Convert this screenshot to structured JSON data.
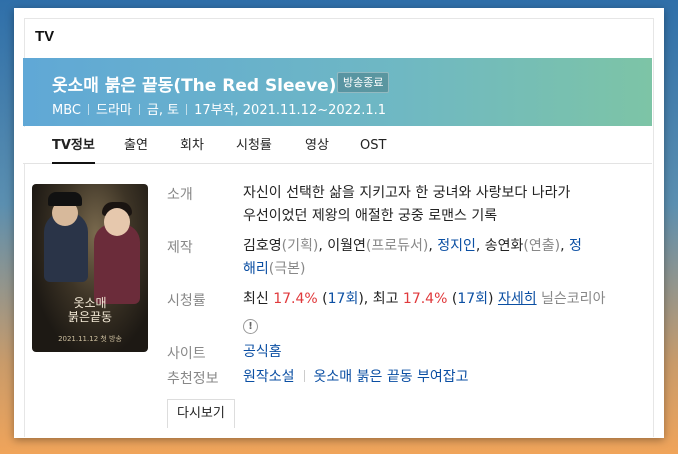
{
  "section_title": "TV",
  "show": {
    "title": "옷소매 붉은 끝동(The Red Sleeve)",
    "status_badge": "방송종료",
    "meta": [
      "MBC",
      "드라마",
      "금, 토",
      "17부작, 2021.11.12~2022.1.1"
    ]
  },
  "tabs": [
    "TV정보",
    "출연",
    "회차",
    "시청률",
    "영상",
    "OST"
  ],
  "poster": {
    "title_line1": "옷소매",
    "title_line2": "붉은끝동",
    "date_text": "2021.11.12 첫 방송"
  },
  "info": {
    "intro_label": "소개",
    "intro_text_line1": "자신이 선택한 삶을 지키고자 한 궁녀와 사랑보다 나라가",
    "intro_text_line2": "우선이었던 제왕의 애절한 궁중 로맨스 기록",
    "production_label": "제작",
    "production": {
      "p1": "김호영",
      "p1_role": "(기획)",
      "sep1": ", ",
      "p2": "이월연",
      "p2_role": "(프로듀서)",
      "sep2": ", ",
      "p3": "정지인",
      "sep3": ", ",
      "p4": "송연화",
      "p4_role": "(연출)",
      "sep4": ", ",
      "p5a": "정",
      "p5b": "해리",
      "p5_role": "(극본)"
    },
    "ratings_label": "시청률",
    "ratings": {
      "latest_label": "최신 ",
      "latest_value": "17.4%",
      "latest_ep_open": " (",
      "latest_ep": "17회",
      "latest_ep_close": "), ",
      "best_label": "최고 ",
      "best_value": "17.4%",
      "best_ep_open": " (",
      "best_ep": "17회",
      "best_ep_close": ") ",
      "detail_link": "자세히",
      "source": " 닐슨코리아",
      "warning_icon_text": "!"
    },
    "site_label": "사이트",
    "site_link": "공식홈",
    "recommend_label": "추천정보",
    "recommend": [
      "원작소설",
      "옷소매 붉은 끝동 부여잡고"
    ],
    "replay_button": "다시보기"
  },
  "colors": {
    "banner_start": "#60a8d6",
    "banner_end": "#7dc4a6",
    "rating_red": "#e0393c",
    "link_blue": "#0b4fa3"
  }
}
